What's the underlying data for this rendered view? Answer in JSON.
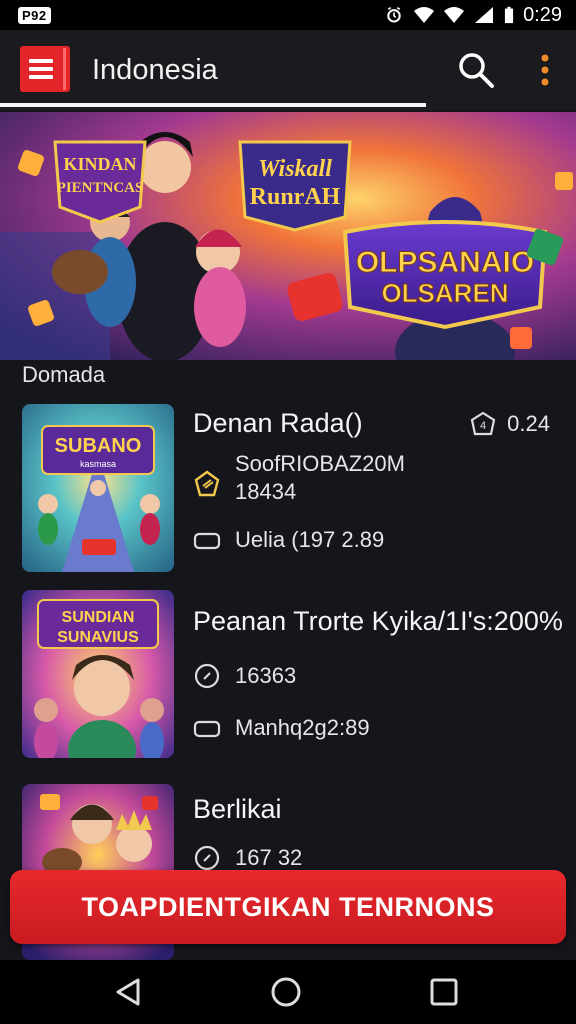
{
  "status_bar": {
    "carrier": "P92",
    "time": "0:29",
    "icons": [
      "alarm-icon",
      "wifi-icon",
      "wifi-signal-icon",
      "cell-signal-icon",
      "battery-icon"
    ]
  },
  "app_bar": {
    "title": "Indonesia",
    "icons": [
      "menu-icon",
      "search-icon",
      "more-vert-icon"
    ],
    "accent_color": "#e3262a"
  },
  "banner": {
    "left_logo": [
      "KINDAN",
      "PIENTNCAS"
    ],
    "middle_logo": [
      "Wiskall",
      "RunrAH"
    ],
    "right_logo": [
      "OLPSANAIO",
      "OLSAREN"
    ]
  },
  "section": {
    "label": "Domada"
  },
  "items": [
    {
      "title": "Denan Rada()",
      "rating": "0.24",
      "meta1": "SoofRIOBAZ20M",
      "meta1b": "18434",
      "meta2": "Uelia (197 2.89",
      "thumb_text": [
        "SUBANO",
        "kasmasa"
      ]
    },
    {
      "title": "Peanan Trorte Kyika/1I's:200%",
      "meta1": "16363",
      "meta2": "Manhq2g2:89",
      "thumb_text": [
        "SUNDIAN",
        "SUNAVIUS"
      ]
    },
    {
      "title": "Berlikai",
      "meta1": "167 32"
    }
  ],
  "cta": {
    "label": "TOAPDIENTGIKAN TENRNONS",
    "color": "#e3262a"
  },
  "nav_bar": {
    "icons": [
      "back-icon",
      "home-icon",
      "recents-icon"
    ]
  }
}
